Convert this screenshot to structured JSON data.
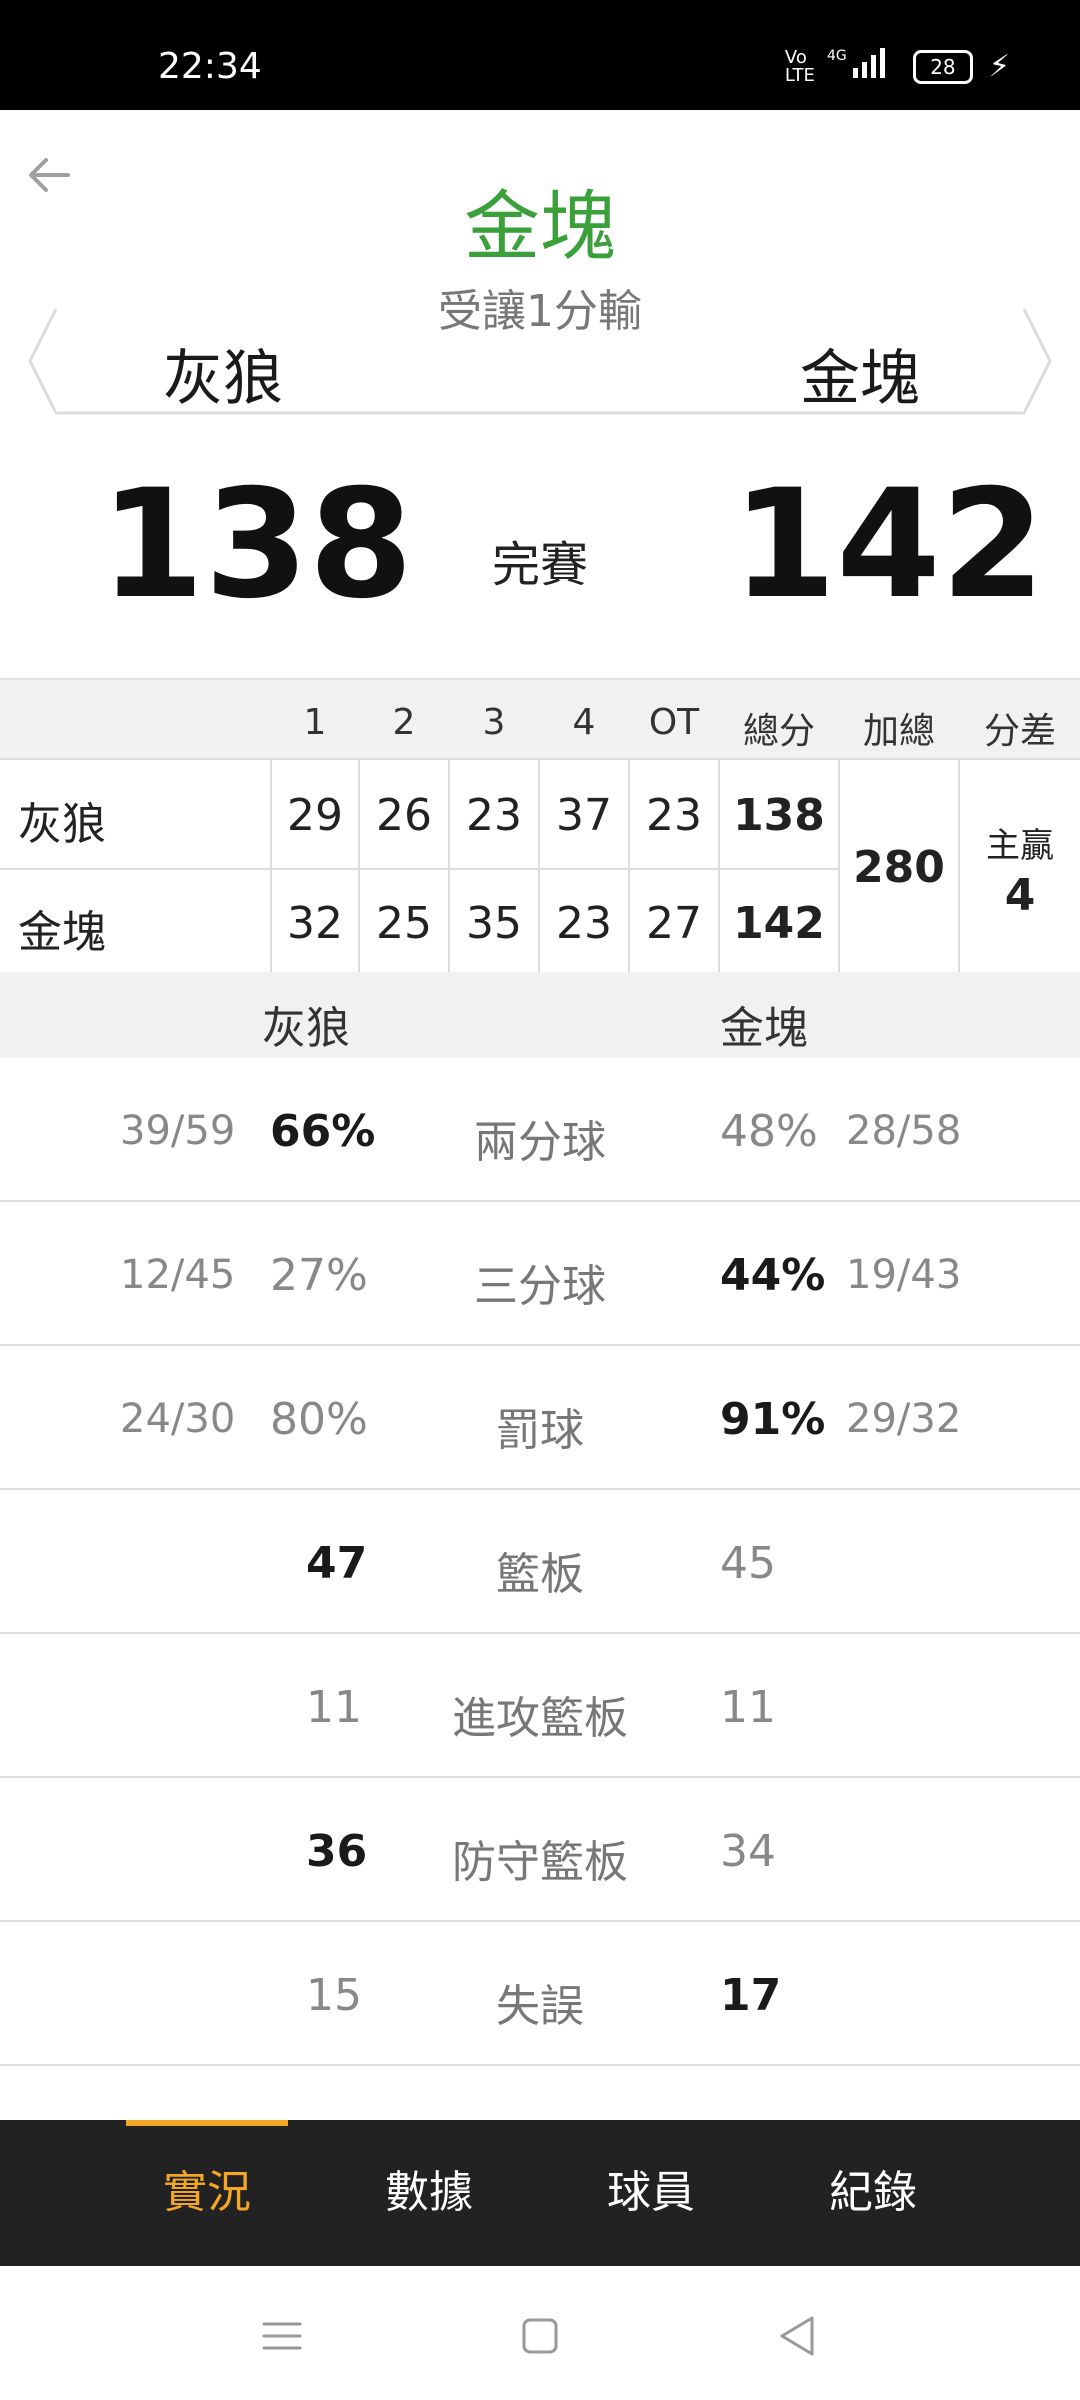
{
  "status_bar": {
    "time": "22:34",
    "network": "4G",
    "volte": "Vo LTE",
    "battery": "28"
  },
  "header": {
    "title": "金塊",
    "subtitle": "受讓1分輸",
    "team_left": "灰狼",
    "team_right": "金塊",
    "title_color": "#3aa13a"
  },
  "score": {
    "left": "138",
    "right": "142",
    "status": "完賽"
  },
  "quarters": {
    "headers": [
      "1",
      "2",
      "3",
      "4",
      "OT",
      "總分",
      "加總",
      "分差"
    ],
    "rows": [
      {
        "team": "灰狼",
        "q": [
          "29",
          "26",
          "23",
          "37",
          "23"
        ],
        "total": "138"
      },
      {
        "team": "金塊",
        "q": [
          "32",
          "25",
          "35",
          "23",
          "27"
        ],
        "total": "142"
      }
    ],
    "sum": "280",
    "diff_label": "主贏",
    "diff_value": "4"
  },
  "stats": {
    "team_left": "灰狼",
    "team_right": "金塊",
    "rows": [
      {
        "label": "兩分球",
        "left_ratio": "39/59",
        "left_pct": "66%",
        "right_pct": "48%",
        "right_ratio": "28/58",
        "leader": "left"
      },
      {
        "label": "三分球",
        "left_ratio": "12/45",
        "left_pct": "27%",
        "right_pct": "44%",
        "right_ratio": "19/43",
        "leader": "right"
      },
      {
        "label": "罰球",
        "left_ratio": "24/30",
        "left_pct": "80%",
        "right_pct": "91%",
        "right_ratio": "29/32",
        "leader": "right"
      },
      {
        "label": "籃板",
        "left": "47",
        "right": "45",
        "leader": "left"
      },
      {
        "label": "進攻籃板",
        "left": "11",
        "right": "11",
        "leader": "none"
      },
      {
        "label": "防守籃板",
        "left": "36",
        "right": "34",
        "leader": "left"
      },
      {
        "label": "失誤",
        "left": "15",
        "right": "17",
        "leader": "right"
      }
    ]
  },
  "tabs": [
    {
      "label": "實況",
      "active": true
    },
    {
      "label": "數據",
      "active": false
    },
    {
      "label": "球員",
      "active": false
    },
    {
      "label": "紀錄",
      "active": false
    }
  ],
  "accent_color": "#f5a623"
}
